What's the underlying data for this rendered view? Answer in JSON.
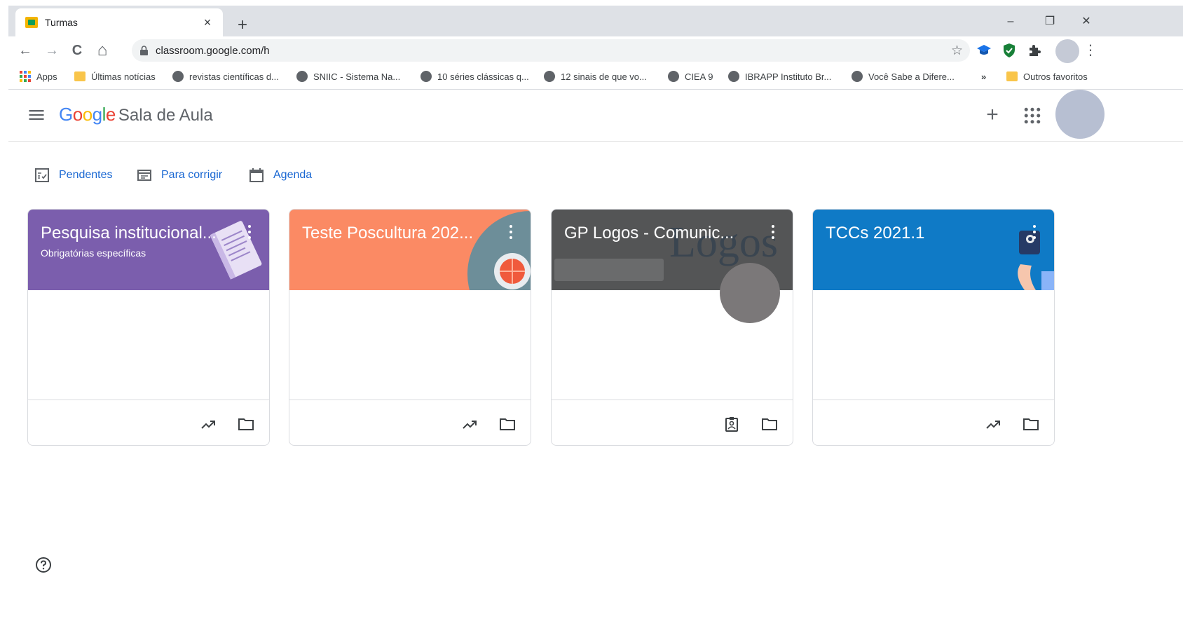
{
  "browser": {
    "tab_title": "Turmas",
    "tab_close": "×",
    "new_tab": "+",
    "minimize": "–",
    "restore": "❐",
    "close": "✕",
    "url": "classroom.google.com/h",
    "back": "←",
    "forward": "→",
    "reload": "C",
    "home": "⌂",
    "star": "☆",
    "menu": "⋮",
    "bookmarks": [
      {
        "label": "Apps",
        "icon": "apps-grid-icon"
      },
      {
        "label": "Últimas notícias",
        "icon": "folder-icon"
      },
      {
        "label": "revistas científicas d...",
        "icon": "globe-icon"
      },
      {
        "label": "SNIIC - Sistema Na...",
        "icon": "globe-icon"
      },
      {
        "label": "10 séries clássicas q...",
        "icon": "globe-icon"
      },
      {
        "label": "12 sinais de que vo...",
        "icon": "globe-icon"
      },
      {
        "label": "CIEA 9",
        "icon": "globe-icon"
      },
      {
        "label": "IBRAPP Instituto Br...",
        "icon": "globe-icon"
      },
      {
        "label": "Você Sabe a Difere...",
        "icon": "globe-icon"
      }
    ],
    "bookmarks_overflow": "»",
    "other_bookmarks": "Outros favoritos"
  },
  "app": {
    "logo_google": [
      "G",
      "o",
      "o",
      "g",
      "l",
      "e"
    ],
    "product": "Sala de Aula",
    "add": "+",
    "links": [
      {
        "label": "Pendentes",
        "icon": "todo-icon"
      },
      {
        "label": "Para corrigir",
        "icon": "review-icon"
      },
      {
        "label": "Agenda",
        "icon": "calendar-icon"
      }
    ],
    "cards": [
      {
        "title": "Pesquisa institucional...",
        "subtitle": "Obrigatórias específicas",
        "color": "#7b5ead",
        "footer": [
          "trending-icon",
          "folder-icon"
        ]
      },
      {
        "title": "Teste Poscultura 202...",
        "subtitle": "",
        "color": "#fb8a64",
        "footer": [
          "trending-icon",
          "folder-icon"
        ]
      },
      {
        "title": "GP Logos - Comunic...",
        "subtitle": "",
        "color": "#545556",
        "banner_text": "Logos",
        "footer": [
          "assignment-ind-icon",
          "folder-icon"
        ]
      },
      {
        "title": "TCCs 2021.1",
        "subtitle": "",
        "color": "#0f7ac6",
        "footer": [
          "trending-icon",
          "folder-icon"
        ]
      }
    ]
  },
  "colors": {
    "link": "#1967d2",
    "chrome": "#dee1e6"
  }
}
